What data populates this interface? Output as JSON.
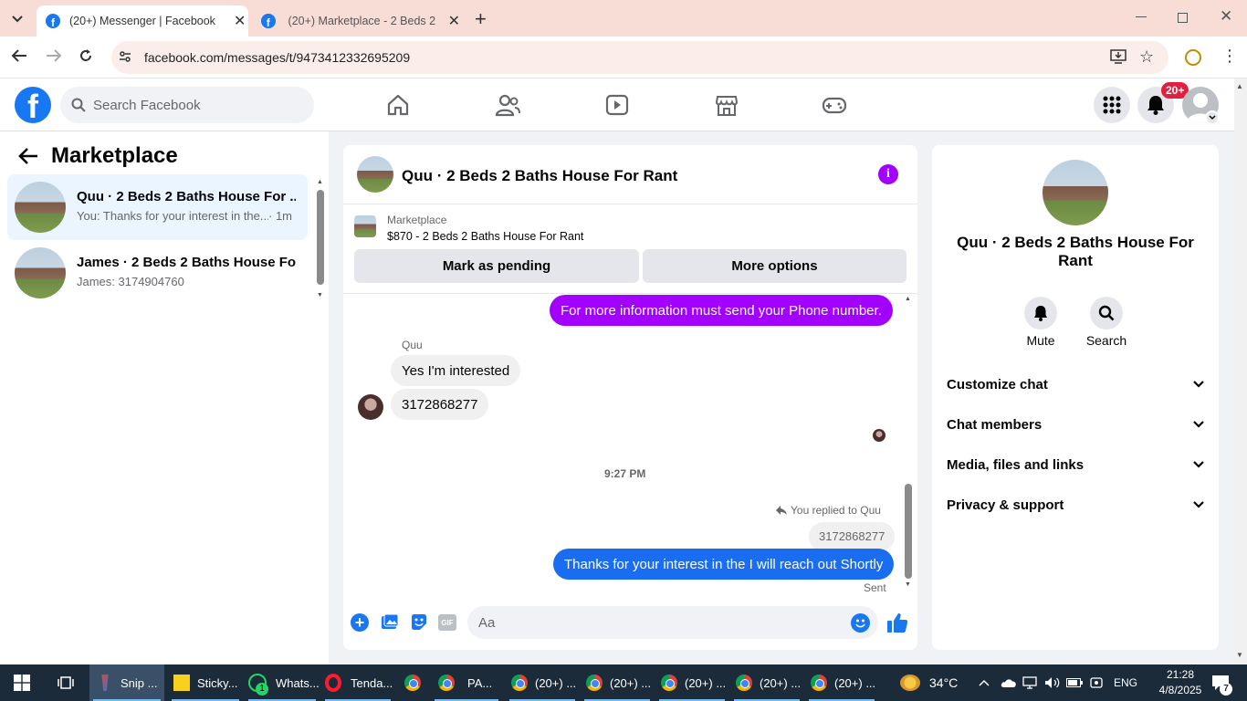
{
  "browser": {
    "tabs": [
      {
        "label": "(20+) Messenger | Facebook",
        "active": true
      },
      {
        "label": "(20+) Marketplace - 2 Beds 2 B",
        "active": false
      }
    ],
    "url": "facebook.com/messages/t/9473412332695209"
  },
  "header": {
    "search_placeholder": "Search Facebook",
    "notif_badge": "20+"
  },
  "left": {
    "title": "Marketplace",
    "conversations": [
      {
        "title": "Quu · 2 Beds 2 Baths House For ...",
        "preview": "You: Thanks for your interest in the...",
        "time": "· 1m",
        "selected": true
      },
      {
        "title": "James · 2 Beds 2 Baths House Fo...",
        "preview": "James: 3174904760",
        "time": "",
        "selected": false
      }
    ]
  },
  "chat": {
    "title": "Quu · 2 Beds 2 Baths House For Rant",
    "listing_source": "Marketplace",
    "listing_detail": "$870 - 2 Beds 2 Baths House For Rant",
    "mark_pending_label": "Mark as pending",
    "more_options_label": "More options",
    "msg_out_1": "For more information must send your Phone number.",
    "sender_name": "Quu",
    "msg_in_1": "Yes I'm interested",
    "msg_in_2": "3172868277",
    "timestamp": "9:27 PM",
    "replied_label": "You replied to Quu",
    "replied_quote": "3172868277",
    "msg_out_2": "Thanks for your interest in the I will reach out Shortly",
    "sent_status": "Sent",
    "composer_placeholder": "Aa"
  },
  "right": {
    "title": "Quu · 2 Beds 2 Baths House For Rant",
    "mute_label": "Mute",
    "search_label": "Search",
    "sections": [
      "Customize chat",
      "Chat members",
      "Media, files and links",
      "Privacy & support"
    ]
  },
  "taskbar": {
    "items": [
      "Snip ...",
      "Sticky...",
      "Whats...",
      "Tenda...",
      "PA...",
      "(20+) ...",
      "(20+) ...",
      "(20+) ...",
      "(20+) ...",
      "(20+) ..."
    ],
    "whatsapp_badge": "1",
    "weather": "34°C",
    "language": "ENG",
    "time": "21:28",
    "date": "4/8/2025",
    "notification_count": "7"
  },
  "colors": {
    "fb_blue": "#1877f2",
    "purple_bubble": "#a200ff",
    "blue_bubble": "#1a6cf0",
    "tab_strip": "#f7ddd5",
    "taskbar": "#1c2b3a"
  }
}
